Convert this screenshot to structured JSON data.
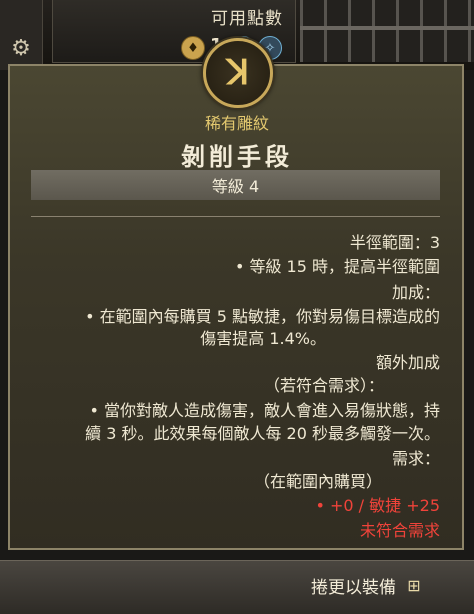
{
  "header": {
    "points_label": "可用點數",
    "badges": [
      {
        "icon": "gold-crest-icon",
        "text": "♦"
      },
      {
        "value": "1"
      },
      {
        "icon": "blue-gem-icon",
        "text": "❖"
      },
      {
        "icon": "blue-gem-small-icon",
        "text": "✧"
      }
    ]
  },
  "card": {
    "emblem_glyph": "ꓘ",
    "rarity": "稀有雕紋",
    "name": "剝削手段",
    "level": "等級 4",
    "lines": [
      "半徑範圍：3",
      "• 等級 15 時，提高半徑範圍",
      "加成：",
      "• 在範圍內每購買 5 點敏捷，你對易傷目標造成的",
      "傷害提高 1.4%。",
      "額外加成",
      "（若符合需求）：",
      "• 當你對敵人造成傷害，敵人會進入易傷狀態，持",
      "續 3 秒。此效果每個敵人每 20 秒最多觸發一次。",
      "需求：",
      "（在範圍內購買）",
      "• +0 / 敏捷 +25",
      "未符合需求"
    ]
  },
  "footer": {
    "action_label": "捲更以裝備",
    "action_icon": "equip-icon",
    "action_glyph": "⊞"
  },
  "colors": {
    "rarity": "#e3c86f",
    "unmet": "#f0433a"
  }
}
